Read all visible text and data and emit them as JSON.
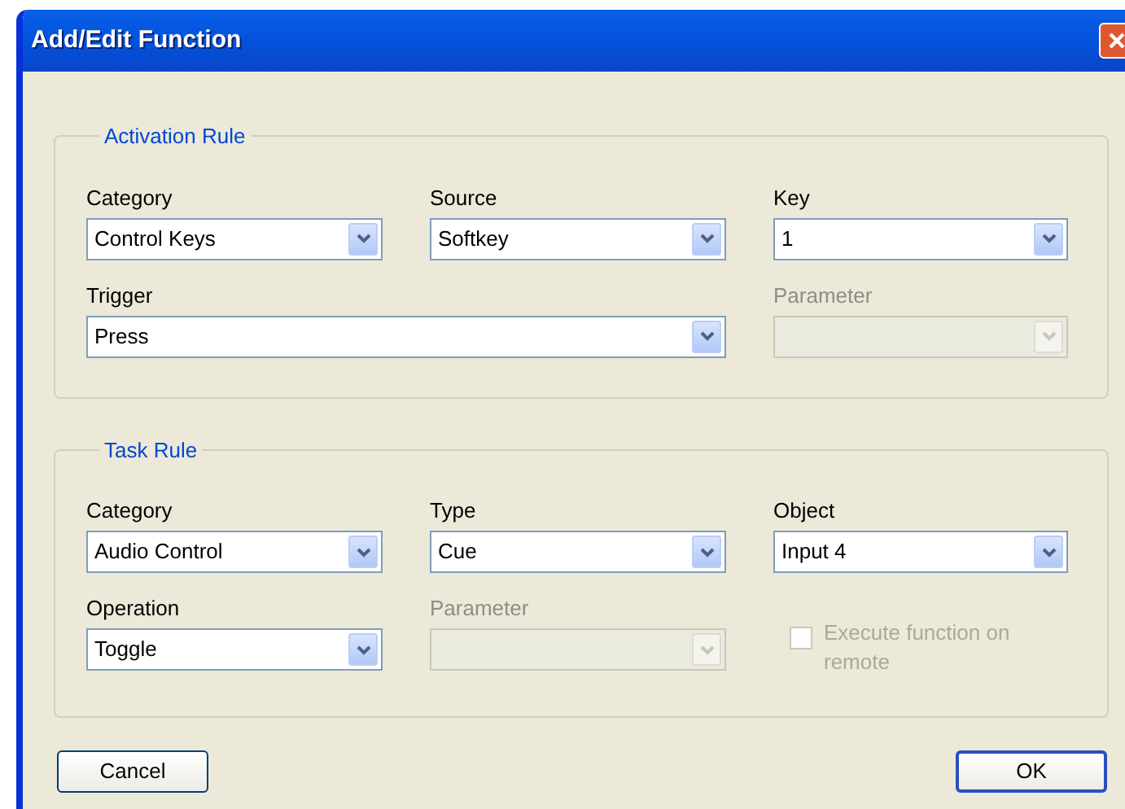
{
  "window": {
    "title": "Add/Edit Function"
  },
  "groups": [
    {
      "title": "Activation Rule",
      "fields": [
        {
          "kind": "combo",
          "label": "Category",
          "value": "Control Keys",
          "disabled": false
        },
        {
          "kind": "combo",
          "label": "Source",
          "value": "Softkey",
          "disabled": false
        },
        {
          "kind": "combo",
          "label": "Key",
          "value": "1",
          "disabled": false
        },
        {
          "kind": "wide_combo",
          "label": "Trigger",
          "value": "Press",
          "disabled": false
        },
        {
          "kind": "combo",
          "label": "Parameter",
          "disabled": true
        }
      ]
    },
    {
      "title": "Task Rule",
      "fields": [
        {
          "kind": "combo",
          "label": "Category",
          "value": "Audio Control",
          "disabled": false
        },
        {
          "kind": "combo",
          "label": "Type",
          "value": "Cue",
          "disabled": false
        },
        {
          "kind": "combo",
          "label": "Object",
          "value": "Input 4",
          "disabled": false
        },
        {
          "kind": "combo",
          "label": "Operation",
          "value": "Toggle",
          "disabled": false
        },
        {
          "kind": "combo",
          "label": "Parameter",
          "disabled": true
        },
        {
          "kind": "checkbox",
          "label": "Execute function on remote",
          "checked": false,
          "disabled": true
        }
      ]
    }
  ],
  "buttons": [
    {
      "label": "Cancel",
      "default": false
    },
    {
      "label": "OK",
      "default": true
    }
  ]
}
